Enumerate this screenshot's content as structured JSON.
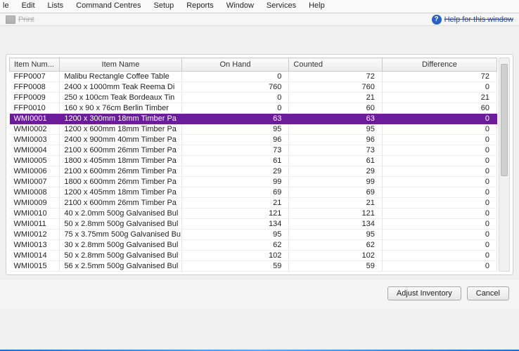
{
  "menu": {
    "items": [
      "le",
      "Edit",
      "Lists",
      "Command Centres",
      "Setup",
      "Reports",
      "Window",
      "Services",
      "Help"
    ]
  },
  "toolbar": {
    "print_label": "Print",
    "help_label": "Help for this window"
  },
  "columns": {
    "item_num": "Item Num...",
    "item_name": "Item Name",
    "on_hand": "On Hand",
    "counted": "Counted",
    "difference": "Difference"
  },
  "rows": [
    {
      "num": "FFP0007",
      "name": "Malibu Rectangle Coffee Table",
      "on_hand": 0,
      "counted": 72,
      "diff": 72,
      "selected": false
    },
    {
      "num": "FFP0008",
      "name": "2400 x 1000mm Teak Reema Di",
      "on_hand": 760,
      "counted": 760,
      "diff": 0,
      "selected": false
    },
    {
      "num": "FFP0009",
      "name": "250 x 100cm Teak Bordeaux Tin",
      "on_hand": 0,
      "counted": 21,
      "diff": 21,
      "selected": false
    },
    {
      "num": "FFP0010",
      "name": "160 x 90 x 76cm Berlin Timber",
      "on_hand": 0,
      "counted": 60,
      "diff": 60,
      "selected": false
    },
    {
      "num": "WMI0001",
      "name": "1200 x 300mm 18mm Timber Pa",
      "on_hand": 63,
      "counted": 63,
      "diff": 0,
      "selected": true
    },
    {
      "num": "WMI0002",
      "name": "1200 x 600mm 18mm Timber Pa",
      "on_hand": 95,
      "counted": 95,
      "diff": 0,
      "selected": false
    },
    {
      "num": "WMI0003",
      "name": "2400 x 900mm 40mm Timber Pa",
      "on_hand": 96,
      "counted": 96,
      "diff": 0,
      "selected": false
    },
    {
      "num": "WMI0004",
      "name": "2100 x 600mm 26mm Timber Pa",
      "on_hand": 73,
      "counted": 73,
      "diff": 0,
      "selected": false
    },
    {
      "num": "WMI0005",
      "name": "1800 x 405mm 18mm Timber Pa",
      "on_hand": 61,
      "counted": 61,
      "diff": 0,
      "selected": false
    },
    {
      "num": "WMI0006",
      "name": "2100 x 600mm 26mm Timber Pa",
      "on_hand": 29,
      "counted": 29,
      "diff": 0,
      "selected": false
    },
    {
      "num": "WMI0007",
      "name": "1800 x 600mm 26mm Timber Pa",
      "on_hand": 99,
      "counted": 99,
      "diff": 0,
      "selected": false
    },
    {
      "num": "WMI0008",
      "name": "1200 x 405mm 18mm Timber Pa",
      "on_hand": 69,
      "counted": 69,
      "diff": 0,
      "selected": false
    },
    {
      "num": "WMI0009",
      "name": "2100 x 600mm 26mm Timber Pa",
      "on_hand": 21,
      "counted": 21,
      "diff": 0,
      "selected": false
    },
    {
      "num": "WMI0010",
      "name": "40 x 2.0mm 500g Galvanised Bul",
      "on_hand": 121,
      "counted": 121,
      "diff": 0,
      "selected": false
    },
    {
      "num": "WMI0011",
      "name": "50 x 2.8mm 500g Galvanised Bul",
      "on_hand": 134,
      "counted": 134,
      "diff": 0,
      "selected": false
    },
    {
      "num": "WMI0012",
      "name": "75 x 3.75mm 500g Galvanised Bu",
      "on_hand": 95,
      "counted": 95,
      "diff": 0,
      "selected": false
    },
    {
      "num": "WMI0013",
      "name": "30 x 2.8mm 500g Galvanised Bul",
      "on_hand": 62,
      "counted": 62,
      "diff": 0,
      "selected": false
    },
    {
      "num": "WMI0014",
      "name": "50 x 2.8mm 500g Galvanised Bul",
      "on_hand": 102,
      "counted": 102,
      "diff": 0,
      "selected": false
    },
    {
      "num": "WMI0015",
      "name": "56 x 2.5mm 500g Galvanised Bul",
      "on_hand": 59,
      "counted": 59,
      "diff": 0,
      "selected": false
    }
  ],
  "buttons": {
    "adjust": "Adjust Inventory",
    "cancel": "Cancel"
  }
}
